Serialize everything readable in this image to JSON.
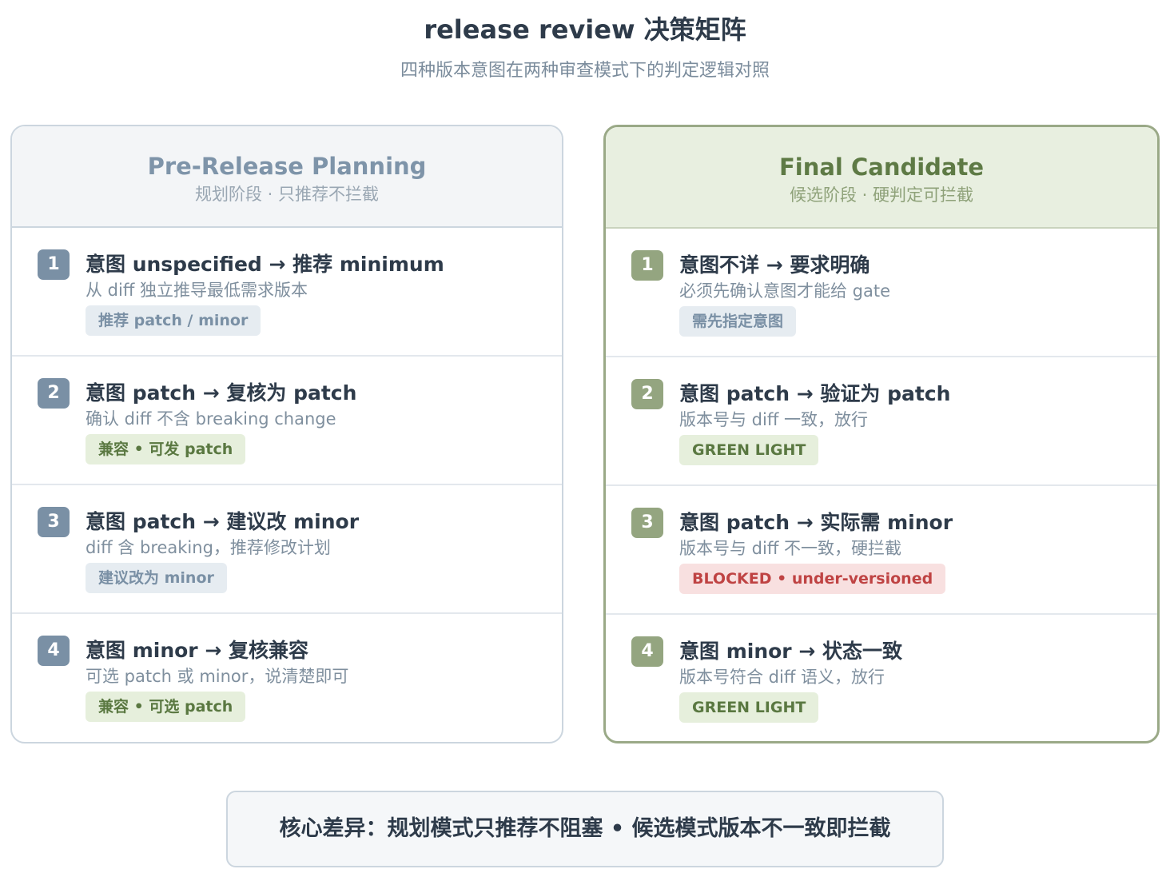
{
  "header": {
    "title": "release review 决策矩阵",
    "subtitle": "四种版本意图在两种审查模式下的判定逻辑对照"
  },
  "panels": [
    {
      "title": "Pre-Release Planning",
      "subtitle": "规划阶段 · 只推荐不拦截",
      "rows": [
        {
          "num": "1",
          "title": "意图 unspecified → 推荐 minimum",
          "desc": "从 diff 独立推导最低需求版本",
          "badge": "推荐 patch / minor",
          "badge_style": "neutral"
        },
        {
          "num": "2",
          "title": "意图 patch → 复核为 patch",
          "desc": "确认 diff 不含 breaking change",
          "badge": "兼容 • 可发 patch",
          "badge_style": "green"
        },
        {
          "num": "3",
          "title": "意图 patch → 建议改 minor",
          "desc": "diff 含 breaking，推荐修改计划",
          "badge": "建议改为 minor",
          "badge_style": "neutral"
        },
        {
          "num": "4",
          "title": "意图 minor → 复核兼容",
          "desc": "可选 patch 或 minor，说清楚即可",
          "badge": "兼容 • 可选 patch",
          "badge_style": "green"
        }
      ]
    },
    {
      "title": "Final Candidate",
      "subtitle": "候选阶段 · 硬判定可拦截",
      "rows": [
        {
          "num": "1",
          "title": "意图不详 → 要求明确",
          "desc": "必须先确认意图才能给 gate",
          "badge": "需先指定意图",
          "badge_style": "neutral"
        },
        {
          "num": "2",
          "title": "意图 patch → 验证为 patch",
          "desc": "版本号与 diff 一致，放行",
          "badge": "GREEN LIGHT",
          "badge_style": "green"
        },
        {
          "num": "3",
          "title": "意图 patch → 实际需 minor",
          "desc": "版本号与 diff 不一致，硬拦截",
          "badge": "BLOCKED • under-versioned",
          "badge_style": "red"
        },
        {
          "num": "4",
          "title": "意图 minor → 状态一致",
          "desc": "版本号符合 diff 语义，放行",
          "badge": "GREEN LIGHT",
          "badge_style": "green"
        }
      ]
    }
  ],
  "footer": {
    "text": "核心差异：规划模式只推荐不阻塞 • 候选模式版本不一致即拦截"
  },
  "colors": {
    "planning_accent": "#7a90a5",
    "candidate_accent": "#94a580",
    "blocked": "#bf4343"
  }
}
